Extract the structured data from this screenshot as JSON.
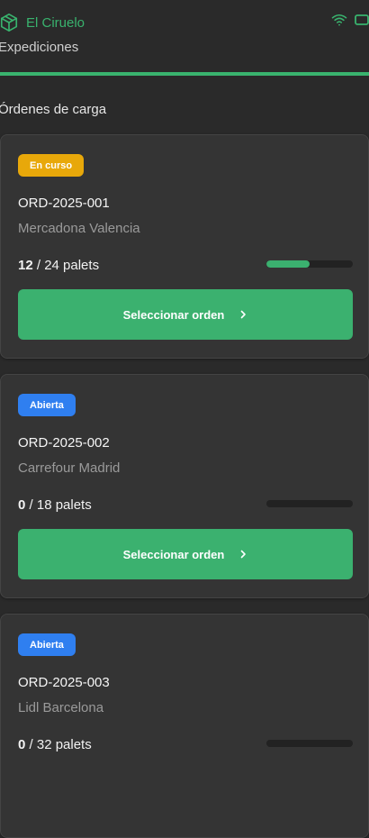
{
  "app": {
    "brand_name": "El Ciruelo",
    "subtitle": "Expediciones"
  },
  "colors": {
    "accent": "#39b36e",
    "badge_running": "#e8a80a",
    "badge_open": "#2f7ff0"
  },
  "icons": {
    "brand": "package-box-icon",
    "wifi": "wifi-icon",
    "battery": "battery-icon",
    "chevron": "chevron-right-icon"
  },
  "section_title": "Órdenes de carga",
  "orders": [
    {
      "status": "En curso",
      "status_type": "running",
      "id": "ORD-2025-001",
      "customer": "Mercadona Valencia",
      "loaded": "12",
      "total_label": " / 24 palets",
      "progress": 0.5,
      "button_label": "Seleccionar orden"
    },
    {
      "status": "Abierta",
      "status_type": "open",
      "id": "ORD-2025-002",
      "customer": "Carrefour Madrid",
      "loaded": "0",
      "total_label": " / 18 palets",
      "progress": 0.0,
      "button_label": "Seleccionar orden"
    },
    {
      "status": "Abierta",
      "status_type": "open",
      "id": "ORD-2025-003",
      "customer": "Lidl Barcelona",
      "loaded": "0",
      "total_label": " / 32 palets",
      "progress": 0.0,
      "button_label": ""
    }
  ]
}
